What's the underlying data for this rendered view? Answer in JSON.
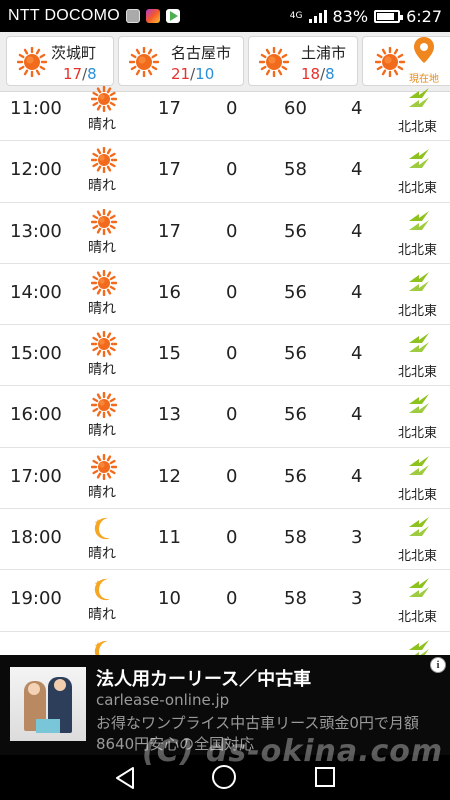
{
  "status_bar": {
    "carrier": "NTT DOCOMO",
    "network": "4G",
    "battery": "83%",
    "battery_level": 0.83,
    "time": "6:27"
  },
  "locations": [
    {
      "name": "茨城町",
      "high": "17",
      "low": "8"
    },
    {
      "name": "名古屋市",
      "high": "21",
      "low": "10"
    },
    {
      "name": "土浦市",
      "high": "18",
      "low": "8"
    }
  ],
  "current_location_label": "現在地",
  "hourly": [
    {
      "time": "11:00",
      "weather": "晴れ",
      "icon": "sun-icon",
      "temp": "17",
      "precip": "0",
      "humidity": "60",
      "wind_speed": "4",
      "wind_dir": "北北東"
    },
    {
      "time": "12:00",
      "weather": "晴れ",
      "icon": "sun-icon",
      "temp": "17",
      "precip": "0",
      "humidity": "58",
      "wind_speed": "4",
      "wind_dir": "北北東"
    },
    {
      "time": "13:00",
      "weather": "晴れ",
      "icon": "sun-icon",
      "temp": "17",
      "precip": "0",
      "humidity": "56",
      "wind_speed": "4",
      "wind_dir": "北北東"
    },
    {
      "time": "14:00",
      "weather": "晴れ",
      "icon": "sun-icon",
      "temp": "16",
      "precip": "0",
      "humidity": "56",
      "wind_speed": "4",
      "wind_dir": "北北東"
    },
    {
      "time": "15:00",
      "weather": "晴れ",
      "icon": "sun-icon",
      "temp": "15",
      "precip": "0",
      "humidity": "56",
      "wind_speed": "4",
      "wind_dir": "北北東"
    },
    {
      "time": "16:00",
      "weather": "晴れ",
      "icon": "sun-icon",
      "temp": "13",
      "precip": "0",
      "humidity": "56",
      "wind_speed": "4",
      "wind_dir": "北北東"
    },
    {
      "time": "17:00",
      "weather": "晴れ",
      "icon": "sun-icon",
      "temp": "12",
      "precip": "0",
      "humidity": "56",
      "wind_speed": "4",
      "wind_dir": "北北東"
    },
    {
      "time": "18:00",
      "weather": "晴れ",
      "icon": "moon-icon",
      "temp": "11",
      "precip": "0",
      "humidity": "58",
      "wind_speed": "3",
      "wind_dir": "北北東"
    },
    {
      "time": "19:00",
      "weather": "晴れ",
      "icon": "moon-icon",
      "temp": "10",
      "precip": "0",
      "humidity": "58",
      "wind_speed": "3",
      "wind_dir": "北北東"
    }
  ],
  "ad": {
    "title": "法人用カーリース／中古車",
    "domain": "carlease-online.jp",
    "description": "お得なワンプライス中古車リース頭金0円で月額8640円安心の全国対応",
    "info_glyph": "i"
  },
  "watermark": "(C) ds-okina.com",
  "colors": {
    "sun": "#f26b1d",
    "moon": "#f5a623",
    "wind_arrow": "#8dc21f",
    "high_temp": "#e5322d",
    "low_temp": "#2a8fd8",
    "pin": "#f0861e"
  }
}
